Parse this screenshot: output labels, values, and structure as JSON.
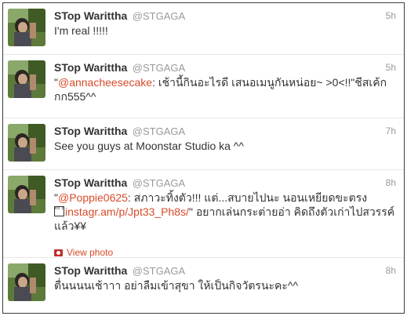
{
  "tweets": [
    {
      "fullname": "STop Warittha",
      "username": "@STGAGA",
      "time": "5h",
      "text_lines": [
        "I'm real !!!!!"
      ]
    },
    {
      "fullname": "STop Warittha",
      "username": "@STGAGA",
      "time": "5h",
      "quote_open": "\"",
      "mention": "@annacheesecake",
      "text_rest": ": เช้านี้กินอะไรดี เสนอเมนูกันหน่อย~ >0<!!\"ชีสเค้ก",
      "text_line2": "กก555^^"
    },
    {
      "fullname": "STop Warittha",
      "username": "@STGAGA",
      "time": "7h",
      "text_lines": [
        "See you guys at Moonstar Studio ka ^^"
      ]
    },
    {
      "fullname": "STop Warittha",
      "username": "@STGAGA",
      "time": "8h",
      "quote_open": "\"",
      "mention": "@Poppie0625",
      "text_rest": ": สภาวะทิ้งตัว!!! แต่...สบายไปนะ นอนเหยียดขะตรง",
      "media_glyph": "E0 E0",
      "link": "instagr.am/p/Jpt33_Ph8s/",
      "text_after_link": "\" อยากเล่นกระต่ายอ่า คิดถึงตัวเก่าไปสวรรค์",
      "text_line3": "แล้ว¥¥",
      "view_photo": "View photo"
    },
    {
      "fullname": "STop Warittha",
      "username": "@STGAGA",
      "time": "8h",
      "text_lines": [
        "ตื่นนนนเช้าาา อย่าลืมเข้าสุขา ให้เป็นกิจวัตรนะคะ^^"
      ]
    }
  ],
  "colors": {
    "link": "#d84b2a",
    "muted": "#999999",
    "text": "#333333",
    "border": "#3c3c3c",
    "separator": "#e8e8e8"
  },
  "icons": {
    "avatar": "profile-photo-avatar",
    "view_photo": "photo-icon"
  }
}
